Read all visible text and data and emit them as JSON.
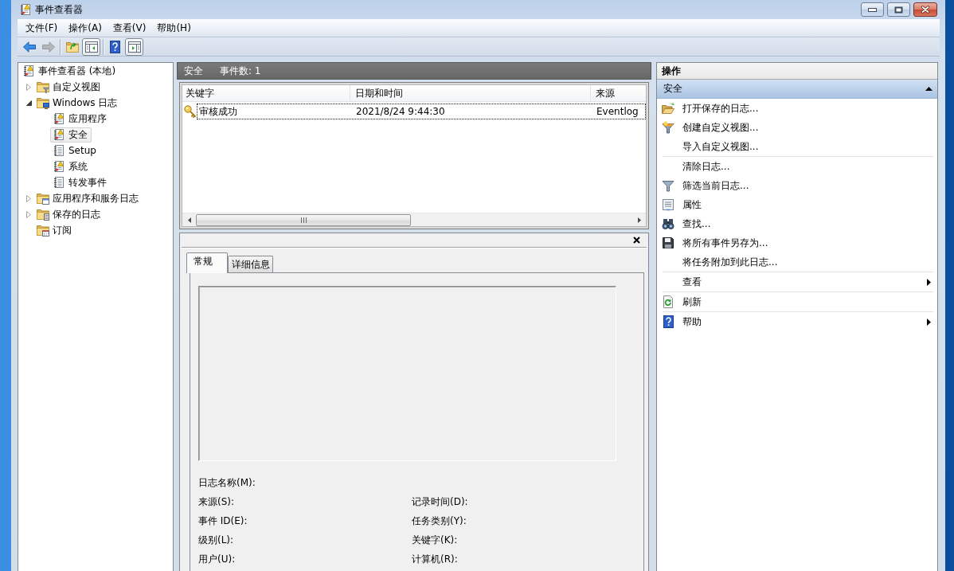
{
  "window": {
    "title": "事件查看器"
  },
  "menu": [
    {
      "label": "文件(F)"
    },
    {
      "label": "操作(A)"
    },
    {
      "label": "查看(V)"
    },
    {
      "label": "帮助(H)"
    }
  ],
  "toolbar": {
    "groups": [
      [
        {
          "kind": "back",
          "disabled": false
        },
        {
          "kind": "forward",
          "disabled": true
        }
      ],
      [
        {
          "kind": "up",
          "disabled": false
        },
        {
          "kind": "tree",
          "disabled": false,
          "on": true
        }
      ],
      [
        {
          "kind": "help",
          "disabled": false
        },
        {
          "kind": "actions",
          "disabled": false,
          "on": true
        }
      ]
    ]
  },
  "tree": [
    {
      "label": "事件查看器 (本地)",
      "kind": "root",
      "selected": false,
      "children": [
        {
          "label": "自定义视图",
          "kind": "views",
          "selected": false,
          "expanded": false
        },
        {
          "label": "Windows 日志",
          "kind": "logs",
          "selected": false,
          "expanded": true,
          "children": [
            {
              "label": "应用程序",
              "kind": "alert",
              "selected": false
            },
            {
              "label": "安全",
              "kind": "alert",
              "selected": true
            },
            {
              "label": "Setup",
              "kind": "plain",
              "selected": false
            },
            {
              "label": "系统",
              "kind": "alert",
              "selected": false
            },
            {
              "label": "转发事件",
              "kind": "plain",
              "selected": false
            }
          ]
        },
        {
          "label": "应用程序和服务日志",
          "kind": "services",
          "selected": false,
          "expanded": false
        },
        {
          "label": "保存的日志",
          "kind": "saved",
          "selected": false,
          "expanded": false
        },
        {
          "label": "订阅",
          "kind": "subscriptions",
          "selected": false
        }
      ]
    }
  ],
  "log_header": {
    "title": "安全",
    "count": "事件数: 1"
  },
  "events": {
    "columns": [
      "关键字",
      "日期和时间",
      "来源"
    ],
    "rows": [
      {
        "kind": "success",
        "focused": true,
        "cells": [
          "审核成功",
          "2021/8/24 9:44:30",
          "Eventlog"
        ]
      }
    ]
  },
  "details": {
    "tabs": [
      {
        "label": "常规",
        "selected": true
      },
      {
        "label": "详细信息",
        "selected": false
      }
    ],
    "fields": [
      {
        "left": "日志名称(M):"
      },
      {
        "left": "来源(S):",
        "right": "记录时间(D):"
      },
      {
        "left": "事件 ID(E):",
        "right": "任务类别(Y):"
      },
      {
        "left": "级别(L):",
        "right": "关键字(K):"
      },
      {
        "left": "用户(U):",
        "right": "计算机(R):"
      }
    ]
  },
  "actions": {
    "title": "操作",
    "section": {
      "title": "安全",
      "expanded": true
    },
    "groups": [
      [
        {
          "label": "打开保存的日志...",
          "kind": "open",
          "submenu": false
        },
        {
          "label": "创建自定义视图...",
          "kind": "create",
          "submenu": false
        },
        {
          "label": "导入自定义视图...",
          "kind": "plain",
          "submenu": false
        }
      ],
      [
        {
          "label": "清除日志...",
          "kind": "plain",
          "submenu": false
        },
        {
          "label": "筛选当前日志...",
          "kind": "filter",
          "submenu": false
        },
        {
          "label": "属性",
          "kind": "properties",
          "submenu": false
        },
        {
          "label": "查找...",
          "kind": "find",
          "submenu": false
        },
        {
          "label": "将所有事件另存为...",
          "kind": "save",
          "submenu": false
        },
        {
          "label": "将任务附加到此日志...",
          "kind": "plain",
          "submenu": false
        }
      ],
      [
        {
          "label": "查看",
          "kind": "plain",
          "submenu": true
        }
      ],
      [
        {
          "label": "刷新",
          "kind": "refresh",
          "submenu": false
        }
      ],
      [
        {
          "label": "帮助",
          "kind": "help",
          "submenu": true
        }
      ]
    ]
  }
}
